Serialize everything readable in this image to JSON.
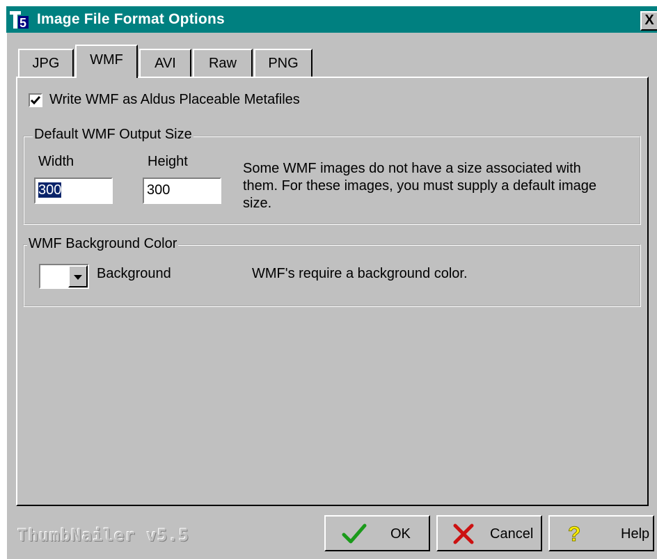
{
  "window": {
    "title": "Image File Format Options",
    "close_label": "X"
  },
  "tabs": [
    {
      "label": "JPG",
      "active": false
    },
    {
      "label": "WMF",
      "active": true
    },
    {
      "label": "AVI",
      "active": false
    },
    {
      "label": "Raw",
      "active": false
    },
    {
      "label": "PNG",
      "active": false
    }
  ],
  "wmf": {
    "placeable_label": "Write WMF as Aldus Placeable Metafiles",
    "placeable_checked": true,
    "size_group": {
      "legend": "Default WMF Output Size",
      "width_label": "Width",
      "width_value": "300",
      "height_label": "Height",
      "height_value": "300",
      "description": "Some WMF images do not have a size associated with them. For these images, you must supply a default image size."
    },
    "bg_group": {
      "legend": "WMF Background Color",
      "color_label": "Background",
      "color_value": "#ffffff",
      "description": "WMF's require a background color."
    }
  },
  "footer": {
    "version": "ThumbNailer v5.5",
    "ok_label": "OK",
    "cancel_label": "Cancel",
    "help_label": "Help",
    "ok_icon": "checkmark-icon",
    "cancel_icon": "x-icon",
    "help_icon": "question-mark-icon"
  },
  "colors": {
    "titlebar": "#008080",
    "face": "#c0c0c0"
  }
}
